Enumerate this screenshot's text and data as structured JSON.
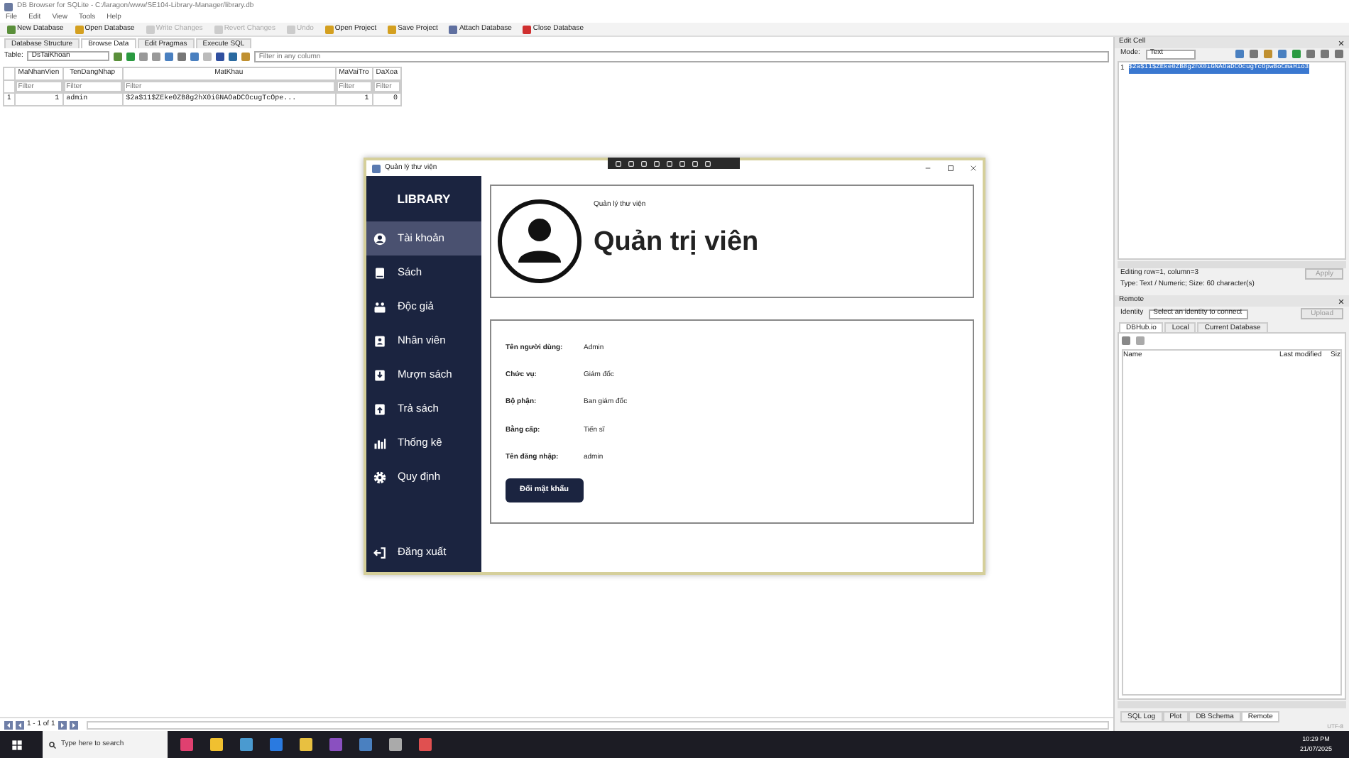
{
  "window": {
    "title": "DB Browser for SQLite - C:/laragon/www/SE104-Library-Manager/library.db"
  },
  "menu": [
    "File",
    "Edit",
    "View",
    "Tools",
    "Help"
  ],
  "toolbar": [
    {
      "label": "New Database",
      "disabled": false
    },
    {
      "label": "Open Database",
      "disabled": false
    },
    {
      "label": "Write Changes",
      "disabled": true
    },
    {
      "label": "Revert Changes",
      "disabled": true
    },
    {
      "label": "Undo",
      "disabled": true
    },
    {
      "label": "Open Project",
      "disabled": false
    },
    {
      "label": "Save Project",
      "disabled": false
    },
    {
      "label": "Attach Database",
      "disabled": false
    },
    {
      "label": "Close Database",
      "disabled": false
    }
  ],
  "tabs": [
    {
      "label": "Database Structure",
      "selected": false
    },
    {
      "label": "Browse Data",
      "selected": true
    },
    {
      "label": "Edit Pragmas",
      "selected": false
    },
    {
      "label": "Execute SQL",
      "selected": false
    }
  ],
  "table_bar": {
    "label": "Table:",
    "table": "DsTaiKhoan",
    "filter_placeholder": "Filter in any column"
  },
  "table": {
    "columns": [
      "MaNhanVien",
      "TenDangNhap",
      "MatKhau",
      "MaVaiTro",
      "DaXoa"
    ],
    "filter_placeholders": [
      "Filter",
      "Filter",
      "Filter",
      "Filter",
      "Filter"
    ],
    "rows": [
      {
        "row_number": "1",
        "cells": [
          "1",
          "admin",
          "$2a$11$ZEke0ZB8g2hX0iGNAOaDCOcugTcOpe...",
          "1",
          "0"
        ]
      }
    ]
  },
  "pager": {
    "text": "1 - 1 of 1"
  },
  "edit_cell": {
    "title": "Edit Cell",
    "mode_label": "Mode:",
    "mode": "Text",
    "line": "1",
    "value": "$2a$11$ZEke0ZB8g2hX0iGNAOaDCOcugTcOpwBoCmaHio3",
    "info": "Editing row=1, column=3",
    "type_info": "Type: Text / Numeric; Size: 60 character(s)",
    "apply": "Apply"
  },
  "remote": {
    "title": "Remote",
    "identity_label": "Identity",
    "identity": "Select an identity to connect",
    "upload": "Upload",
    "tabs": [
      {
        "label": "DBHub.io",
        "selected": true
      },
      {
        "label": "Local",
        "selected": false
      },
      {
        "label": "Current Database",
        "selected": false
      }
    ],
    "columns": [
      "Name",
      "Last modified",
      "Siz"
    ]
  },
  "bottom_tabs": [
    {
      "label": "SQL Log",
      "selected": false
    },
    {
      "label": "Plot",
      "selected": false
    },
    {
      "label": "DB Schema",
      "selected": false
    },
    {
      "label": "Remote",
      "selected": true
    }
  ],
  "encoding": "UTF-8",
  "app": {
    "title": "Quản lý thư viện",
    "brand": "LIBRARY",
    "nav": [
      {
        "label": "Tài khoản",
        "selected": true
      },
      {
        "label": "Sách",
        "selected": false
      },
      {
        "label": "Độc giả",
        "selected": false
      },
      {
        "label": "Nhân viên",
        "selected": false
      },
      {
        "label": "Mượn sách",
        "selected": false
      },
      {
        "label": "Trả sách",
        "selected": false
      },
      {
        "label": "Thống kê",
        "selected": false
      },
      {
        "label": "Quy định",
        "selected": false
      }
    ],
    "logout": "Đăng xuất",
    "profile": {
      "subtitle": "Quản lý thư viện",
      "name": "Quản trị viên"
    },
    "fields": [
      {
        "label": "Tên người dùng:",
        "value": "Admin"
      },
      {
        "label": "Chức vụ:",
        "value": "Giám đốc"
      },
      {
        "label": "Bộ phận:",
        "value": "Ban giám đốc"
      },
      {
        "label": "Bằng cấp:",
        "value": "Tiến sĩ"
      },
      {
        "label": "Tên đăng nhập:",
        "value": "admin"
      }
    ],
    "button": "Đổi mật khẩu"
  },
  "taskbar": {
    "search_placeholder": "Type here to search",
    "time": "10:29 PM",
    "date": "21/07/2025"
  }
}
